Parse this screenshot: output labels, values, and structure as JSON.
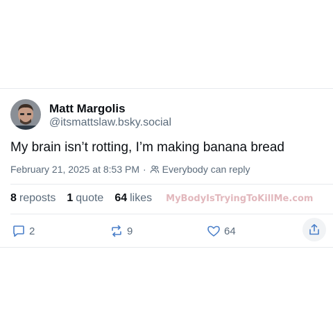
{
  "author": {
    "name": "Matt Margolis",
    "handle": "@itsmattslaw.bsky.social",
    "avatar_icon": "profile-photo"
  },
  "post": {
    "text": "My brain isn’t rotting, I’m making banana bread",
    "date": "February 21, 2025 at 8:53 PM",
    "separator": "·",
    "reply_setting": "Everybody can reply"
  },
  "stats": {
    "reposts_count": "8",
    "reposts_label": "reposts",
    "quotes_count": "1",
    "quotes_label": "quote",
    "likes_count": "64",
    "likes_label": "likes"
  },
  "watermark": "MyBodyIsTryingToKillMe.com",
  "actions": {
    "reply_count": "2",
    "repost_count": "9",
    "like_count": "64",
    "share_icon": "share-icon"
  },
  "colors": {
    "text_primary": "#0b0f14",
    "text_secondary": "#5b6b7b",
    "divider": "#e6e9ed",
    "watermark": "#e2b8bd"
  }
}
